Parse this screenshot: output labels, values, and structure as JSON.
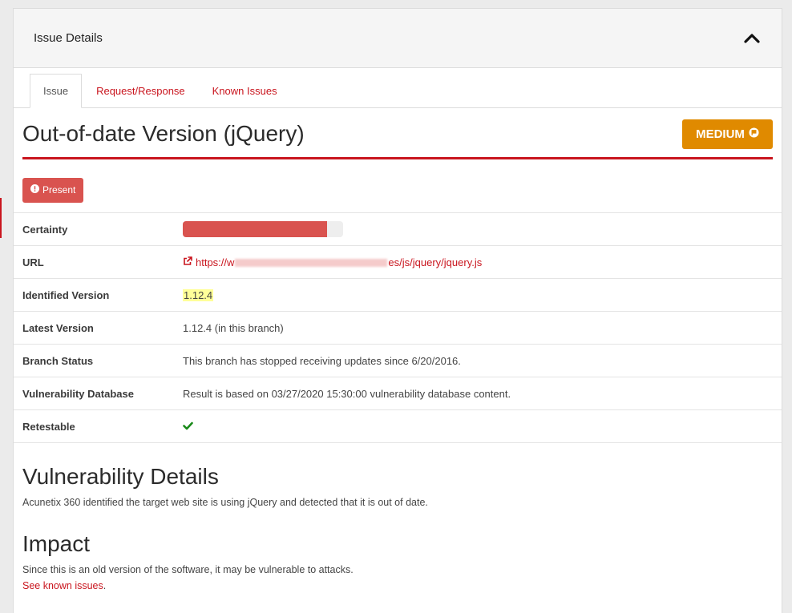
{
  "panel": {
    "title": "Issue Details"
  },
  "tabs": [
    {
      "label": "Issue",
      "active": true
    },
    {
      "label": "Request/Response",
      "active": false
    },
    {
      "label": "Known Issues",
      "active": false
    }
  ],
  "issue": {
    "title": "Out-of-date Version (jQuery)",
    "severity": "MEDIUM",
    "status": "Present"
  },
  "details": {
    "certainty": {
      "label": "Certainty",
      "value_fraction": 0.9,
      "color": "#d9534f"
    },
    "url": {
      "label": "URL",
      "prefix": "https://w",
      "suffix": "es/js/jquery/jquery.js"
    },
    "identified_version": {
      "label": "Identified Version",
      "value": "1.12.4"
    },
    "latest_version": {
      "label": "Latest Version",
      "value": "1.12.4 (in this branch)"
    },
    "branch_status": {
      "label": "Branch Status",
      "value": "This branch has stopped receiving updates since 6/20/2016."
    },
    "vulnerability_database": {
      "label": "Vulnerability Database",
      "value": "Result is based on 03/27/2020 15:30:00 vulnerability database content."
    },
    "retestable": {
      "label": "Retestable",
      "icon": "checkmark-icon"
    }
  },
  "sections": {
    "vulnerability_details": {
      "heading": "Vulnerability Details",
      "text": "Acunetix 360 identified the target web site is using jQuery and detected that it is out of date."
    },
    "impact": {
      "heading": "Impact",
      "text": "Since this is an old version of the software, it may be vulnerable to attacks.",
      "link": "See known issues",
      "link_suffix": "."
    }
  },
  "colors": {
    "accent": "#c9151e",
    "severity_medium": "#e08a00",
    "status_present": "#d9534f",
    "check": "#1a8a1a"
  }
}
